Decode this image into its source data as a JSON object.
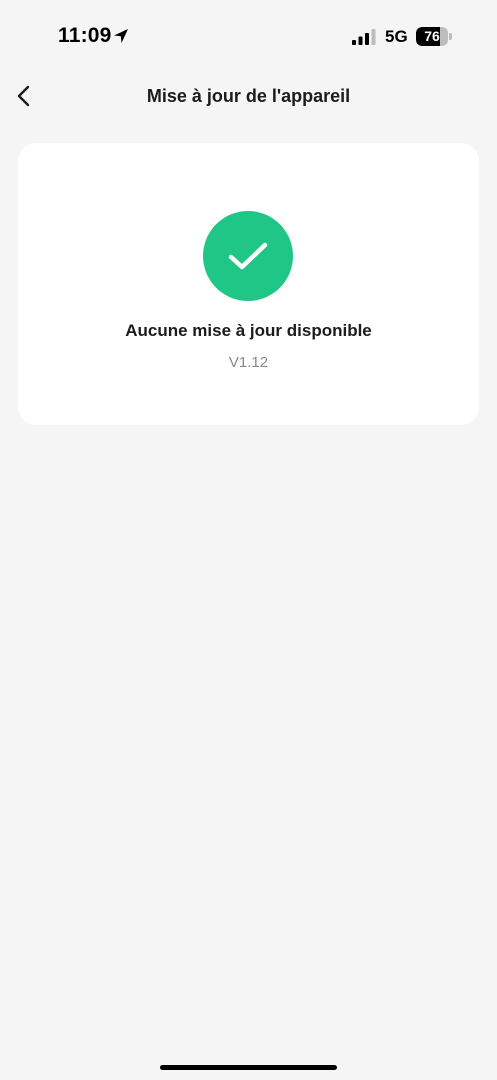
{
  "status_bar": {
    "time": "11:09",
    "network": "5G",
    "battery_level": "76",
    "battery_fraction": 0.76,
    "icons": [
      "location-arrow-icon",
      "cellular-signal-icon",
      "battery-icon"
    ]
  },
  "nav": {
    "title": "Mise à jour de l'appareil",
    "back_icon": "chevron-left-icon"
  },
  "update_card": {
    "status_icon": "checkmark-circle-icon",
    "message": "Aucune mise à jour disponible",
    "version": "V1.12"
  },
  "colors": {
    "background": "#f5f5f5",
    "card": "#ffffff",
    "success": "#1fc685",
    "text_primary": "#1c1c1e",
    "text_secondary": "#8a8a8e"
  }
}
